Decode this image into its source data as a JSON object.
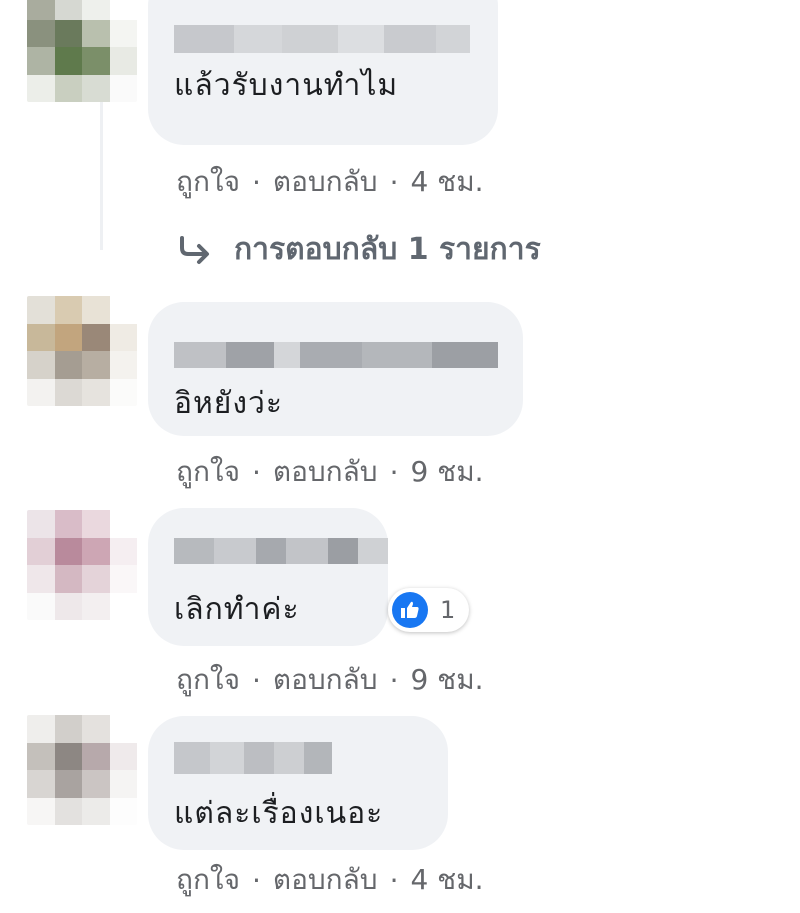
{
  "colors": {
    "bubble": "#f0f2f5",
    "action_text": "#65676b",
    "like_blue": "#1877f2"
  },
  "comments": [
    {
      "text": "แล้วรับงานทำไม",
      "like": "ถูกใจ",
      "reply": "ตอบกลับ",
      "time": "4 ชม.",
      "replies_link": "การตอบกลับ 1 รายการ"
    },
    {
      "text": "อิหยังว่ะ",
      "like": "ถูกใจ",
      "reply": "ตอบกลับ",
      "time": "9 ชม."
    },
    {
      "text": "เลิกทำค่ะ",
      "like": "ถูกใจ",
      "reply": "ตอบกลับ",
      "time": "9 ชม.",
      "reaction_icon": "thumbs-up-icon",
      "reaction_count": "1"
    },
    {
      "text": "แต่ละเรื่องเนอะ",
      "like": "ถูกใจ",
      "reply": "ตอบกลับ",
      "time": "4 ชม."
    }
  ]
}
